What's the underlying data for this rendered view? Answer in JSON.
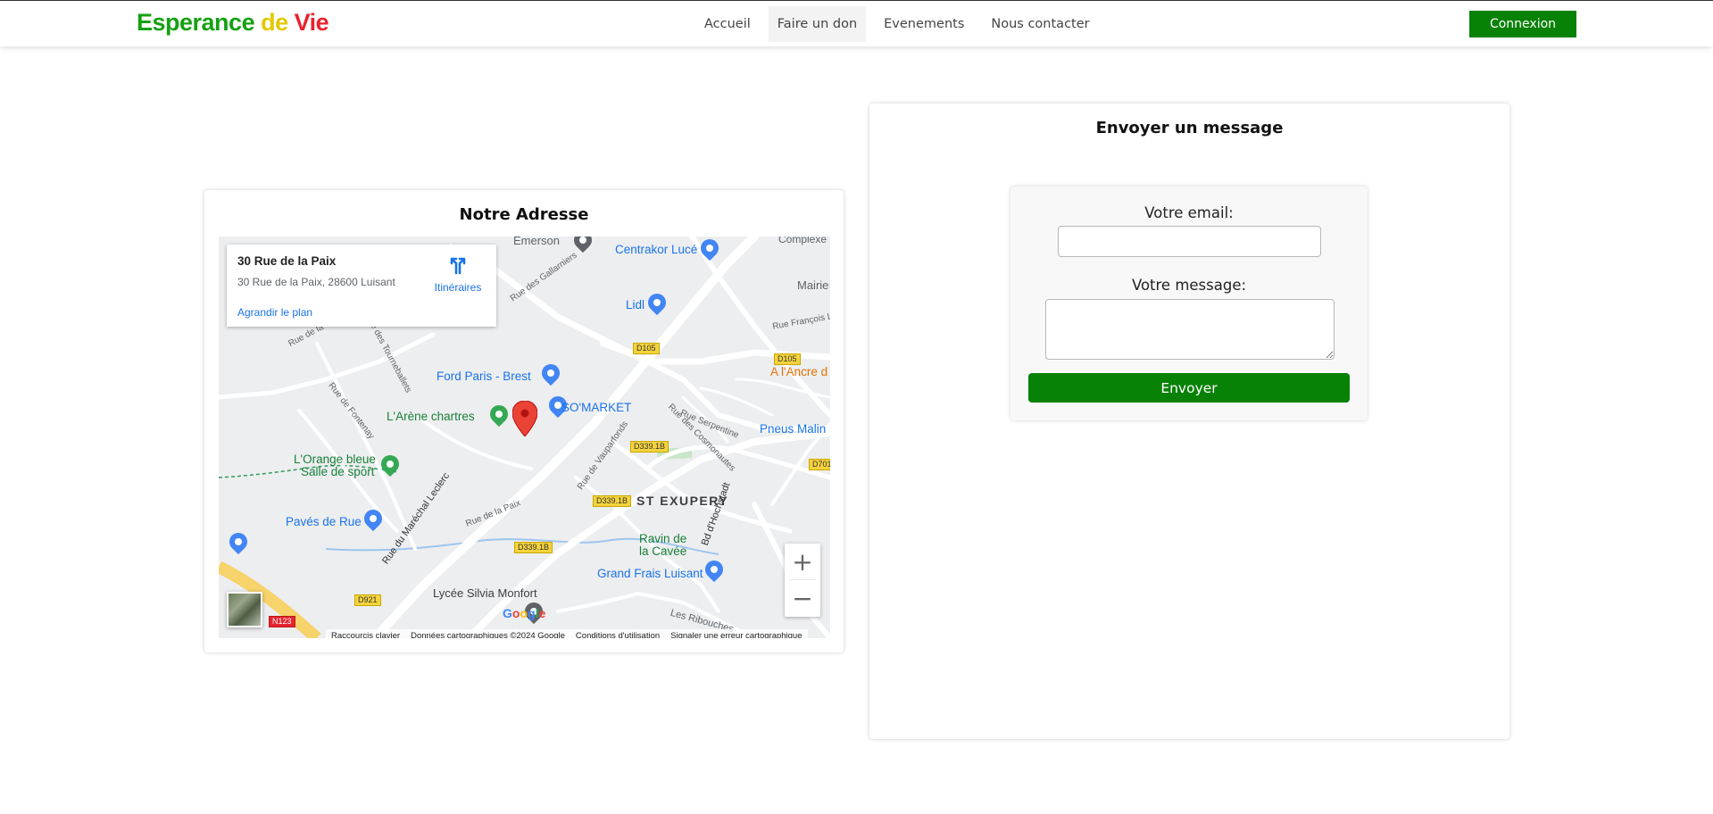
{
  "navbar": {
    "brand": {
      "part1": "Esperance",
      "part2": "de",
      "part3": "Vie"
    },
    "links": [
      {
        "label": "Accueil"
      },
      {
        "label": "Faire un don",
        "active": true
      },
      {
        "label": "Evenements"
      },
      {
        "label": "Nous contacter"
      }
    ],
    "login_label": "Connexion",
    "colors": {
      "accent": "#088107",
      "brand_green": "#16a012",
      "brand_yellow": "#e3c900",
      "brand_red": "#e8232f"
    }
  },
  "address": {
    "title": "Notre Adresse",
    "map": {
      "place_name": "30 Rue de la Paix",
      "place_address": "30 Rue de la Paix, 28600 Luisant",
      "directions_label": "Itinéraires",
      "enlarge_label": "Agrandir le plan",
      "zoom_in": "+",
      "zoom_out": "−",
      "google_logo": "Google",
      "attribution": {
        "shortcuts": "Raccourcis clavier",
        "data": "Données cartographiques ©2024 Google",
        "terms": "Conditions d'utilisation",
        "report": "Signaler une erreur cartographique"
      },
      "labels": {
        "emerson": "Emerson",
        "centrakor": "Centrakor Lucé",
        "complexe": "Complexe Henri",
        "mairie": "Mairie",
        "lidl": "Lidl",
        "ford": "Ford Paris - Brest",
        "ancre": "A l'Ancre d",
        "somarket": "SO'MARKET",
        "arene": "L'Arène chartres",
        "pneus": "Pneus Malin",
        "orange_bleue_1": "L'Orange bleue",
        "orange_bleue_2": "Salle de sport",
        "paves": "Pavés de Rue",
        "st_exupery": "ST EXUPERY",
        "ravin_1": "Ravin de",
        "ravin_2": "la Cavée",
        "grand_frais": "Grand Frais Luisant",
        "lycee": "Lycée Silvia Monfort",
        "rue_gallarniers": "Rue des Gallarniers",
        "rue_taye": "Rue de la Taye",
        "rue_tourneballets": "Rue des Tourneballets",
        "rue_fontenay": "Rue de Fontenay",
        "rue_francois": "Rue François L",
        "rue_serpentine": "Rue Serpentine",
        "rue_cosmonautes": "Rue des Cosmonautes",
        "rue_vauparfonds": "Rue de Vauparfonds",
        "rue_marechal": "Rue du Maréchal Leclerc",
        "rue_paix": "Rue de la Paix",
        "bd_hochstadt": "Bd d'Hochstadt",
        "ribouches": "Les Ribouches"
      },
      "road_badges": {
        "d105_a": "D105",
        "d105_b": "D105",
        "d339_a": "D339.1B",
        "d339_b": "D339.1B",
        "d339_c": "D339.1B",
        "d701": "D701",
        "d921": "D921",
        "n123": "N123"
      }
    }
  },
  "message": {
    "title": "Envoyer un message",
    "email_label": "Votre email:",
    "email_value": "",
    "message_label": "Votre message:",
    "message_value": "",
    "send_label": "Envoyer"
  }
}
